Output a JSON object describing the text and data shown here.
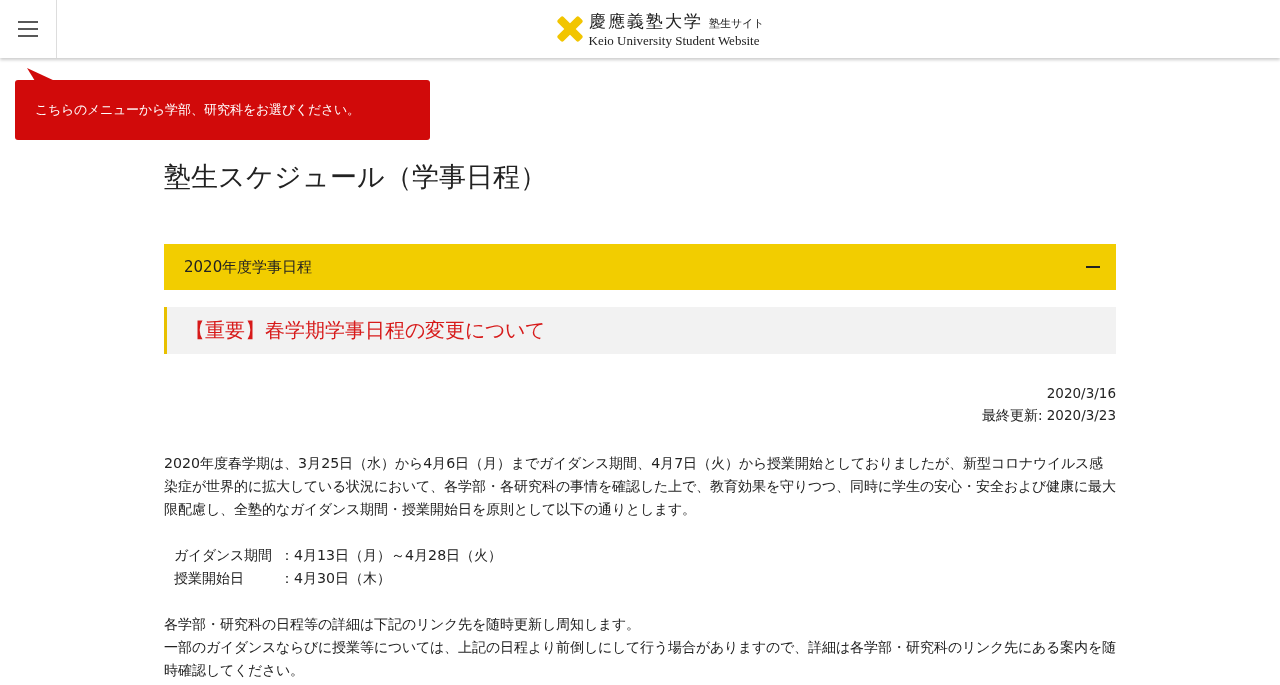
{
  "header": {
    "logo": {
      "title_jp": "慶應義塾大学",
      "subtitle_jp": "塾生サイト",
      "title_en": "Keio University Student Website"
    }
  },
  "tooltip": "こちらのメニューから学部、研究科をお選びください。",
  "page_title": "塾生スケジュール（学事日程）",
  "accordion": {
    "title": "2020年度学事日程",
    "expanded": true
  },
  "notice_title": "【重要】春学期学事日程の変更について",
  "dates": [
    "2020/3/16",
    "最終更新: 2020/3/23"
  ],
  "intro": "2020年度春学期は、3月25日（水）から4月6日（月）までガイダンス期間、4月7日（火）から授業開始としておりましたが、新型コロナウイルス感染症が世界的に拡大している状況において、各学部・各研究科の事情を確認した上で、教育効果を守りつつ、同時に学生の安心・安全および健康に最大限配慮し、全塾的なガイダンス期間・授業開始日を原則として以下の通りとします。",
  "schedule": [
    {
      "label": "ガイダンス期間",
      "value": "：4月13日（月）～4月28日（火）"
    },
    {
      "label": "授業開始日",
      "value": "：4月30日（木）"
    }
  ],
  "notes": [
    "各学部・研究科の日程等の詳細は下記のリンク先を随時更新し周知します。",
    "一部のガイダンスならびに授業等については、上記の日程より前倒しにして行う場合がありますので、詳細は各学部・研究科のリンク先にある案内を随時確認してください。"
  ]
}
